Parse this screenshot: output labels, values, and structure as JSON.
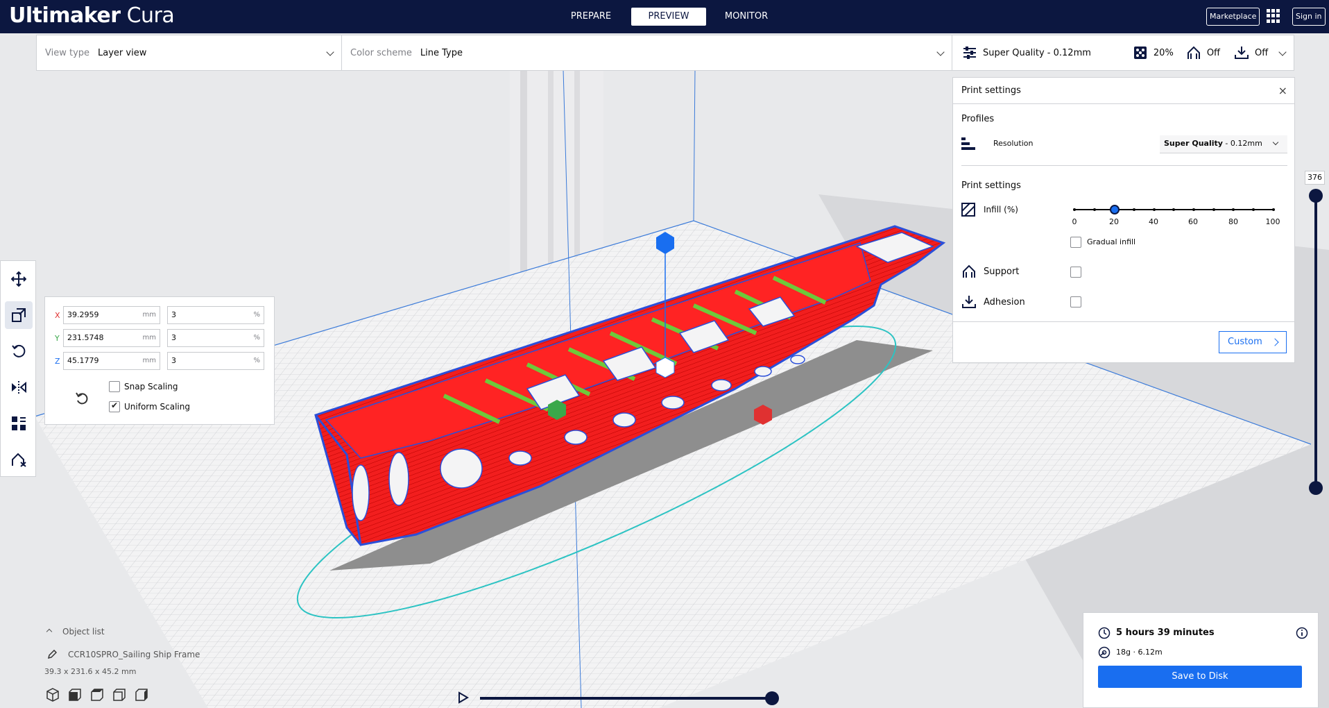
{
  "app": {
    "logo_bold": "Ultimaker",
    "logo_light": " Cura"
  },
  "stages": [
    {
      "label": "PREPARE",
      "active": false
    },
    {
      "label": "PREVIEW",
      "active": true
    },
    {
      "label": "MONITOR",
      "active": false
    }
  ],
  "header_buttons": {
    "marketplace": "Marketplace",
    "signin": "Sign in"
  },
  "view_bar": {
    "view_type_label": "View type",
    "view_type_value": "Layer view",
    "color_scheme_label": "Color scheme",
    "color_scheme_value": "Line Type",
    "profile": "Super Quality - 0.12mm",
    "infill": "20%",
    "support": "Off",
    "adhesion": "Off"
  },
  "print_settings": {
    "title": "Print settings",
    "profiles_heading": "Profiles",
    "resolution_label": "Resolution",
    "resolution_bold": "Super Quality",
    "resolution_rest": " - 0.12mm",
    "settings_heading": "Print settings",
    "infill_label": "Infill (%)",
    "infill_ticks": [
      "0",
      "20",
      "40",
      "60",
      "80",
      "100"
    ],
    "infill_value": 20,
    "gradual_label": "Gradual infill",
    "support_label": "Support",
    "adhesion_label": "Adhesion",
    "custom_label": "Custom"
  },
  "scale": {
    "rows": [
      {
        "axis": "X",
        "mm": "39.2959",
        "unit": "mm",
        "pct": "3",
        "pct_unit": "%"
      },
      {
        "axis": "Y",
        "mm": "231.5748",
        "unit": "mm",
        "pct": "3",
        "pct_unit": "%"
      },
      {
        "axis": "Z",
        "mm": "45.1779",
        "unit": "mm",
        "pct": "3",
        "pct_unit": "%"
      }
    ],
    "snap_label": "Snap Scaling",
    "snap_checked": false,
    "uniform_label": "Uniform Scaling",
    "uniform_checked": true
  },
  "object_list": {
    "heading": "Object list",
    "object_name": "CCR10SPRO_Sailing Ship Frame",
    "dimensions": "39.3 x 231.6 x 45.2 mm"
  },
  "layer_slider": {
    "value": "376"
  },
  "estimate": {
    "time": "5 hours 39 minutes",
    "material": "18g · 6.12m",
    "save_label": "Save to Disk"
  },
  "colors": {
    "header": "#0c1740",
    "accent": "#196ef0",
    "model": "#ff1a1a",
    "infill": "#6ec93b"
  }
}
